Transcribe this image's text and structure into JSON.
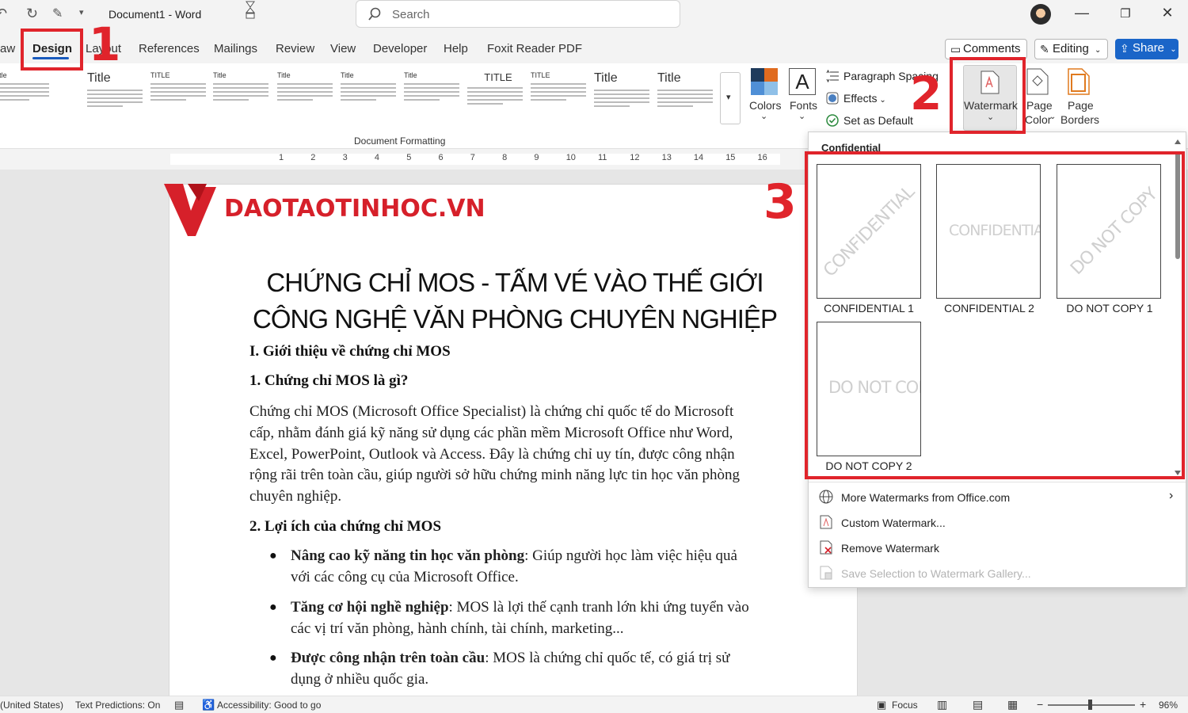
{
  "titlebar": {
    "doc_title": "Document1  -  Word",
    "search_placeholder": "Search"
  },
  "tabs": {
    "items": [
      "aw",
      "Design",
      "Layout",
      "References",
      "Mailings",
      "Review",
      "View",
      "Developer",
      "Help",
      "Foxit Reader PDF"
    ],
    "active": "Design",
    "comments": "Comments",
    "editing": "Editing",
    "share": "Share"
  },
  "ribbon": {
    "style_titles": [
      "Title",
      "Title",
      "TITLE",
      "Title",
      "Title",
      "Title",
      "Title",
      "TITLE",
      "TITLE",
      "Title",
      "Title"
    ],
    "group_label": "Document Formatting",
    "colors": "Colors",
    "fonts": "Fonts",
    "paragraph_spacing": "Paragraph Spacing",
    "effects": "Effects",
    "set_as_default": "Set as Default",
    "watermark": "Watermark",
    "page_color_1": "Page",
    "page_color_2": "Color",
    "page_borders_1": "Page",
    "page_borders_2": "Borders"
  },
  "annotations": {
    "step1": "1",
    "step2": "2",
    "step3": "3",
    "color": "#e0242b"
  },
  "ruler": {
    "numbers": [
      "1",
      "2",
      "3",
      "4",
      "5",
      "6",
      "7",
      "8",
      "9",
      "10",
      "11",
      "12",
      "13",
      "14",
      "15",
      "16"
    ]
  },
  "document": {
    "logo": "DAOTAOTINHOC.VN",
    "title_line1": "CHỨNG CHỈ MOS - TẤM VÉ VÀO THẾ GIỚI",
    "title_line2": "CÔNG NGHỆ VĂN PHÒNG CHUYÊN NGHIỆP",
    "section1": "I. Giới thiệu về chứng chỉ MOS",
    "subsection1": "1. Chứng chỉ MOS là gì?",
    "paragraph_lines": [
      "Chứng chỉ MOS (Microsoft Office Specialist) là chứng chỉ quốc tế do Microsoft",
      "cấp, nhằm đánh giá kỹ năng sử dụng các phần mềm Microsoft Office như Word,",
      "Excel, PowerPoint, Outlook và Access. Đây là chứng chỉ uy tín, được công nhận",
      "rộng rãi trên toàn cầu, giúp người sở hữu chứng minh năng lực tin học văn phòng",
      "chuyên nghiệp."
    ],
    "subsection2": "2. Lợi ích của chứng chỉ MOS",
    "bullets": [
      {
        "bold": "Nâng cao kỹ năng tin học văn phòng",
        "rest": ": Giúp người học làm việc hiệu quả",
        "line2": "với các công cụ của Microsoft Office."
      },
      {
        "bold": "Tăng cơ hội nghề nghiệp",
        "rest": ": MOS là lợi thế cạnh tranh lớn khi ứng tuyển vào",
        "line2": "các vị trí văn phòng, hành chính, tài chính, marketing..."
      },
      {
        "bold": "Được công nhận trên toàn cầu",
        "rest": ": MOS là chứng chỉ quốc tế, có giá trị sử",
        "line2": "dụng ở nhiều quốc gia."
      }
    ]
  },
  "watermark_menu": {
    "header": "Confidential",
    "thumbnails": [
      {
        "text": "CONFIDENTIAL",
        "label": "CONFIDENTIAL 1"
      },
      {
        "text": "CONFIDENTIAL",
        "label": "CONFIDENTIAL 2"
      },
      {
        "text": "DO NOT COPY",
        "label": "DO NOT COPY 1"
      },
      {
        "text": "DO NOT COPY",
        "label": "DO NOT COPY 2"
      }
    ],
    "more": "More Watermarks from Office.com",
    "custom": "Custom Watermark...",
    "remove": "Remove Watermark",
    "save": "Save Selection to Watermark Gallery..."
  },
  "statusbar": {
    "language": "(United States)",
    "text_predictions": "Text Predictions: On",
    "accessibility": "Accessibility: Good to go",
    "focus": "Focus",
    "zoom": "96%",
    "zoom_level": 0.5
  }
}
